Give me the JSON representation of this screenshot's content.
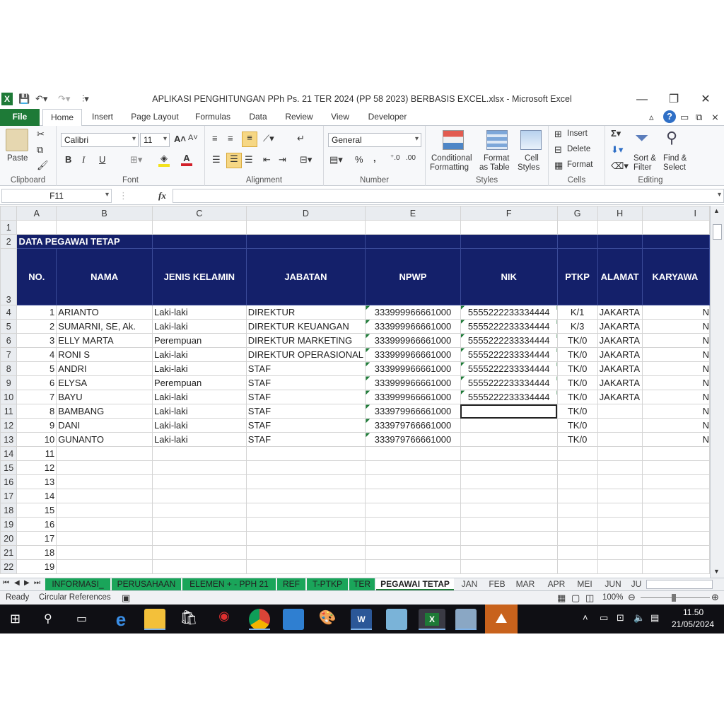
{
  "window": {
    "title": "APLIKASI PENGHITUNGAN PPh Ps. 21 TER 2024 (PP 58 2023) BERBASIS EXCEL.xlsx  -  Microsoft Excel",
    "minimize": "—",
    "restore": "❐",
    "close": "✕"
  },
  "ribbon_tabs": [
    "File",
    "Home",
    "Insert",
    "Page Layout",
    "Formulas",
    "Data",
    "Review",
    "View",
    "Developer"
  ],
  "ribbon": {
    "clipboard": {
      "paste": "Paste",
      "label": "Clipboard"
    },
    "font": {
      "name": "Calibri",
      "size": "11",
      "label": "Font",
      "bold": "B",
      "italic": "I",
      "underline": "U"
    },
    "alignment": {
      "label": "Alignment"
    },
    "number": {
      "format": "General",
      "label": "Number",
      "percent": "%",
      "comma": ","
    },
    "styles": {
      "conditional1": "Conditional",
      "conditional2": "Formatting",
      "format_table1": "Format",
      "format_table2": "as Table",
      "cell_styles1": "Cell",
      "cell_styles2": "Styles",
      "label": "Styles"
    },
    "cells": {
      "insert": "Insert",
      "delete": "Delete",
      "format": "Format",
      "label": "Cells"
    },
    "editing": {
      "sort1": "Sort &",
      "sort2": "Filter",
      "find1": "Find &",
      "find2": "Select",
      "label": "Editing"
    }
  },
  "formula_bar": {
    "name_box": "F11",
    "fx": "fx",
    "value": ""
  },
  "columns": [
    "A",
    "B",
    "C",
    "D",
    "E",
    "F",
    "G",
    "H",
    "I"
  ],
  "sheet": {
    "title_row": "DATA PEGAWAI TETAP",
    "headers": [
      "NO.",
      "NAMA",
      "JENIS KELAMIN",
      "JABATAN",
      "NPWP",
      "NIK",
      "PTKP",
      "ALAMAT",
      "KARYAWA"
    ],
    "rows": [
      {
        "row": "4",
        "no": "1",
        "nama": "ARIANTO",
        "jk": "Laki-laki",
        "jabatan": "DIREKTUR",
        "npwp": "333999966661000",
        "nik": "5555222233334444",
        "ptkp": "K/1",
        "alamat": "JAKARTA",
        "kar": "N"
      },
      {
        "row": "5",
        "no": "2",
        "nama": "SUMARNI, SE, Ak.",
        "jk": "Laki-laki",
        "jabatan": "DIREKTUR KEUANGAN",
        "npwp": "333999966661000",
        "nik": "5555222233334444",
        "ptkp": "K/3",
        "alamat": "JAKARTA",
        "kar": "N"
      },
      {
        "row": "6",
        "no": "3",
        "nama": "ELLY MARTA",
        "jk": "Perempuan",
        "jabatan": "DIREKTUR MARKETING",
        "npwp": "333999966661000",
        "nik": "5555222233334444",
        "ptkp": "TK/0",
        "alamat": "JAKARTA",
        "kar": "N"
      },
      {
        "row": "7",
        "no": "4",
        "nama": "RONI S",
        "jk": "Laki-laki",
        "jabatan": "DIREKTUR OPERASIONAL",
        "npwp": "333999966661000",
        "nik": "5555222233334444",
        "ptkp": "TK/0",
        "alamat": "JAKARTA",
        "kar": "N"
      },
      {
        "row": "8",
        "no": "5",
        "nama": "ANDRI",
        "jk": "Laki-laki",
        "jabatan": "STAF",
        "npwp": "333999966661000",
        "nik": "5555222233334444",
        "ptkp": "TK/0",
        "alamat": "JAKARTA",
        "kar": "N"
      },
      {
        "row": "9",
        "no": "6",
        "nama": "ELYSA",
        "jk": "Perempuan",
        "jabatan": "STAF",
        "npwp": "333999966661000",
        "nik": "5555222233334444",
        "ptkp": "TK/0",
        "alamat": "JAKARTA",
        "kar": "N"
      },
      {
        "row": "10",
        "no": "7",
        "nama": "BAYU",
        "jk": "Laki-laki",
        "jabatan": "STAF",
        "npwp": "333999966661000",
        "nik": "5555222233334444",
        "ptkp": "TK/0",
        "alamat": "JAKARTA",
        "kar": "N"
      },
      {
        "row": "11",
        "no": "8",
        "nama": "BAMBANG",
        "jk": "Laki-laki",
        "jabatan": "STAF",
        "npwp": "333979966661000",
        "nik": "",
        "ptkp": "TK/0",
        "alamat": "",
        "kar": "N"
      },
      {
        "row": "12",
        "no": "9",
        "nama": "DANI",
        "jk": "Laki-laki",
        "jabatan": "STAF",
        "npwp": "333979766661000",
        "nik": "",
        "ptkp": "TK/0",
        "alamat": "",
        "kar": "N"
      },
      {
        "row": "13",
        "no": "10",
        "nama": "GUNANTO",
        "jk": "Laki-laki",
        "jabatan": "STAF",
        "npwp": "333979766661000",
        "nik": "",
        "ptkp": "TK/0",
        "alamat": "",
        "kar": "N"
      }
    ],
    "empty_rows": [
      {
        "row": "14",
        "no": "11"
      },
      {
        "row": "15",
        "no": "12"
      },
      {
        "row": "16",
        "no": "13"
      },
      {
        "row": "17",
        "no": "14"
      },
      {
        "row": "18",
        "no": "15"
      },
      {
        "row": "19",
        "no": "16"
      },
      {
        "row": "20",
        "no": "17"
      },
      {
        "row": "21",
        "no": "18"
      },
      {
        "row": "22",
        "no": "19"
      }
    ]
  },
  "sheet_tabs": [
    "INFORMASI_",
    "PERUSAHAAN",
    "ELEMEN + - PPH 21",
    "REF",
    "T-PTKP",
    "TER",
    "PEGAWAI TETAP",
    "JAN",
    "FEB",
    "MAR",
    "APR",
    "MEI",
    "JUN",
    "JU"
  ],
  "status": {
    "ready": "Ready",
    "circular": "Circular References",
    "zoom": "100%"
  },
  "taskbar": {
    "time": "11.50",
    "date": "21/05/2024"
  }
}
